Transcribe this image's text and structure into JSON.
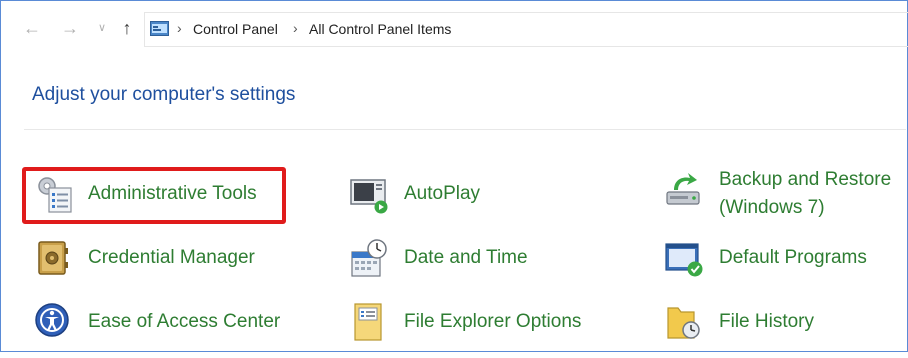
{
  "address_bar": {
    "back_icon": "arrow-left-icon",
    "forward_icon": "arrow-right-icon",
    "recent_icon": "chevron-down-icon",
    "up_icon": "arrow-up-icon",
    "breadcrumbs": [
      "Control Panel",
      "All Control Panel Items"
    ]
  },
  "page": {
    "title": "Adjust your computer's settings"
  },
  "items": [
    {
      "label": "Administrative Tools",
      "icon": "administrative-tools-icon",
      "highlighted": true
    },
    {
      "label": "AutoPlay",
      "icon": "autoplay-icon"
    },
    {
      "label": "Backup and Restore",
      "label2": "(Windows 7)",
      "icon": "backup-restore-icon"
    },
    {
      "label": "Credential Manager",
      "icon": "credential-manager-icon"
    },
    {
      "label": "Date and Time",
      "icon": "date-time-icon"
    },
    {
      "label": "Default Programs",
      "icon": "default-programs-icon"
    },
    {
      "label": "Ease of Access Center",
      "icon": "ease-of-access-icon"
    },
    {
      "label": "File Explorer Options",
      "icon": "file-explorer-options-icon"
    },
    {
      "label": "File History",
      "icon": "file-history-icon"
    }
  ],
  "colors": {
    "link_green": "#2e7d32",
    "title_blue": "#1e4f9e",
    "highlight_red": "#e01b1b"
  }
}
